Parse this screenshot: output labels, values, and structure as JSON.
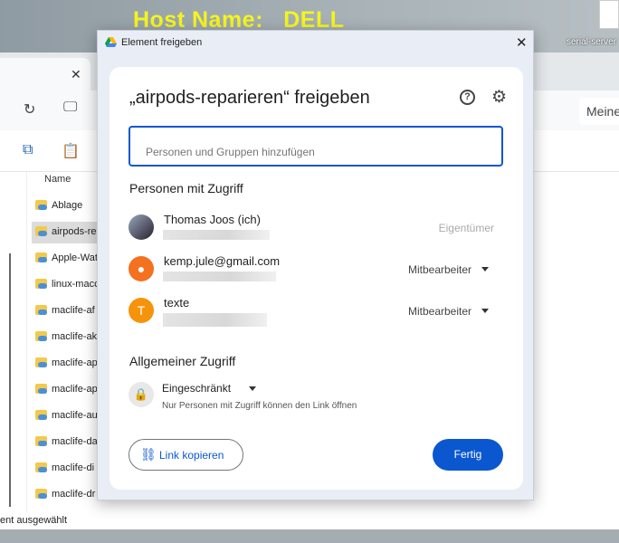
{
  "desktop": {
    "host_label": "Host Name:   DELL",
    "icon_label": "serial-server"
  },
  "explorer": {
    "address_fragment": "Meine",
    "column_name": "Name",
    "files": [
      "Ablage",
      "airpods-re",
      "Apple-Wat",
      "linux-macc",
      "maclife-af",
      "maclife-ak",
      "maclife-ap",
      "maclife-ap",
      "maclife-au",
      "maclife-da",
      "maclife-di",
      "maclife-dr"
    ],
    "status": "ent ausgewählt"
  },
  "dialog": {
    "window_title": "Element freigeben",
    "title": "„airpods-reparieren“ freigeben",
    "search_placeholder": "Personen und Gruppen hinzufügen",
    "people_heading": "Personen mit Zugriff",
    "people": [
      {
        "name": "Thomas Joos (ich)",
        "role": "Eigentümer",
        "avatar": ""
      },
      {
        "name": "kemp.jule@gmail.com",
        "role": "Mitbearbeiter",
        "avatar": ""
      },
      {
        "name": "texte",
        "role": "Mitbearbeiter",
        "avatar": "T"
      }
    ],
    "general_heading": "Allgemeiner Zugriff",
    "access_level": "Eingeschränkt",
    "access_desc": "Nur Personen mit Zugriff können den Link öffnen",
    "copy_link": "Link kopieren",
    "done": "Fertig"
  },
  "colors": {
    "accent": "#0b57d0",
    "avatar_orange": "#f4711f",
    "avatar_amber": "#f5930a",
    "host_text": "#f5f51e"
  }
}
